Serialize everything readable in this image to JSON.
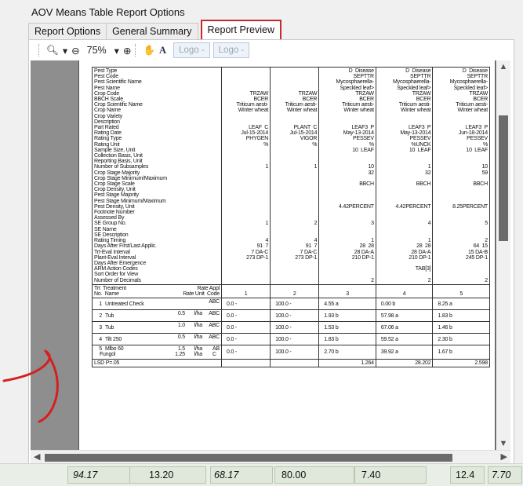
{
  "window_title": "AOV Means Table Report Options",
  "tabs": [
    "Report Options",
    "General Summary",
    "Report Preview"
  ],
  "toolbar": {
    "zoom": "75%",
    "logo1": "Logo -",
    "logo2": "Logo -"
  },
  "preview": {
    "cut_top_line": "",
    "labels": "Pest Type\nPest Code\nPest Scientific Name\nPest Name\nCrop Code\nBBCH Scale\nCrop Scientific Name\nCrop Name\nCrop Variety\nDescription\nPart Rated\nRating Date\nRating Type\nRating Unit\nSample Size, Unit\nCollection Basis, Unit\nReporting Basis, Unit\nNumber of Subsamples\nCrop Stage Majority\nCrop Stage Minimum/Maximum\nCrop Stage Scale\nCrop Density, Unit\nPest Stage Majority\nPest Stage Minimum/Maximum\nPest Density, Unit\nFootnote Number\nAssessed By\nSE Group No.\nSE Name\nSE Description\nRating Timing\nDays After First/Last Applic.\nTrt-Eval Interval\nPlant-Eval Interval\nDays After Emergence\nARM Action Codes\nSort Order for View\nNumber of Decimals",
    "columns": [
      "\n\n\n\nTRZAW\nBCER\nTriticum aesti-\nWinter wheat\n\n\nLEAF  C\nJul-15-2014\nPHYGEN\n%\n\n\n\n1\n\n\n\n\n\n\n\n\n\n1\n\n\n4\n91  7\n7 DA-C\n273 DP-1\n\n\n\n",
      "\n\n\n\nTRZAW\nBCER\nTriticum aesti-\nWinter wheat\n\n\nPLANT  C\nJul-15-2014\nVIGOR\n%\n\n\n\n1\n\n\n\n\n\n\n\n\n\n2\n\n\n4\n91  7\n7 DA-C\n273 DP-1\n\n\n\n",
      "D  Disease\nSEPTTR\nMycosphaerella-\nSpeckled leaf>\nTRZAW\nBCER\nTriticum aesti-\nWinter wheat\n\n\nLEAF3  P\nMay-13-2014\nPESSEV\n%\n10  LEAF\n\n\n10\n32\n\nBBCH\n\n\n\n4.42PERCENT\n\n\n3\n\n\n1\n28  28\n28 DA-A\n210 DP-1\n\n\n\n2",
      "D  Disease\nSEPTTR\nMycosphaerella-\nSpeckled leaf>\nTRZAW\nBCER\nTriticum aesti-\nWinter wheat\n\n\nLEAF3  P\nMay-13-2014\nPESSEV\n%UNCK\n10  LEAF\n\n\n1\n32\n\nBBCH\n\n\n\n4.42PERCENT\n\n\n4\n\n\n1\n28  28\n28 DA-A\n210 DP-1\n\nTAB[3]\n\n2",
      "D  Disease\nSEPTTR\nMycosphaerella-\nSpeckled leaf>\nTRZAW\nBCER\nTriticum aesti-\nWinter wheat\n\n\nLEAF3  P\nJun-18-2014\nPESSEV\n%\n10  LEAF\n\n\n10\n59\n\nBBCH\n\n\n\n8.25PERCENT\n\n\n5\n\n\n2\n64  15\n15 DA-B\n245 DP-1\n\n\n\n2"
    ],
    "trt_header": {
      "left": "Trt  Treatment\nNo.  Name",
      "mid": "Rate Appl\nRate Unit  Code",
      "cols": [
        "1",
        "2",
        "3",
        "4",
        "5"
      ]
    },
    "treatments": [
      {
        "no": "1",
        "name": "Untreated Check",
        "rate": "",
        "unit": "",
        "code": "ABC",
        "vals": [
          "0.0 -",
          "100.0 -",
          "4.55 a",
          "0.00 b",
          "8.25 a"
        ]
      },
      {
        "no": "2",
        "name": "Tub",
        "rate": "0.5",
        "unit": "l/ha",
        "code": "ABC",
        "vals": [
          "0.0 -",
          "100.0 -",
          "1.93 b",
          "57.98 a",
          "1.83 b"
        ]
      },
      {
        "no": "3",
        "name": "Tub",
        "rate": "1.0",
        "unit": "l/ha",
        "code": "ABC",
        "vals": [
          "0.0 -",
          "100.0 -",
          "1.53 b",
          "67.06 a",
          "1.46 b"
        ]
      },
      {
        "no": "4",
        "name": "Tilt 250",
        "rate": "0.5",
        "unit": "l/ha",
        "code": "ABC",
        "vals": [
          "0.0 -",
          "100.0 -",
          "1.83 b",
          "59.52 a",
          "2.30 b"
        ]
      },
      {
        "no": "5",
        "name": "Mlbo 60\n    Fungol",
        "rate": "1.5\n1.25",
        "unit": "l/ha\nl/ha",
        "code": "AB\nC",
        "vals": [
          "0.0 -",
          "100.0 -",
          "2.70 b",
          "39.92 a",
          "1.67 b"
        ]
      }
    ],
    "lsd": {
      "label": "LSD P=.05",
      "vals": [
        "",
        "",
        "1.264",
        "28.202",
        "2.598"
      ]
    }
  },
  "bottom_row": [
    "94.17",
    "13.20",
    "68.17",
    "80.00",
    "7.40",
    "12.4",
    "7.70"
  ],
  "colors": {
    "tab_highlight": "#c62b2b",
    "annotation_stroke": "#d42020"
  }
}
